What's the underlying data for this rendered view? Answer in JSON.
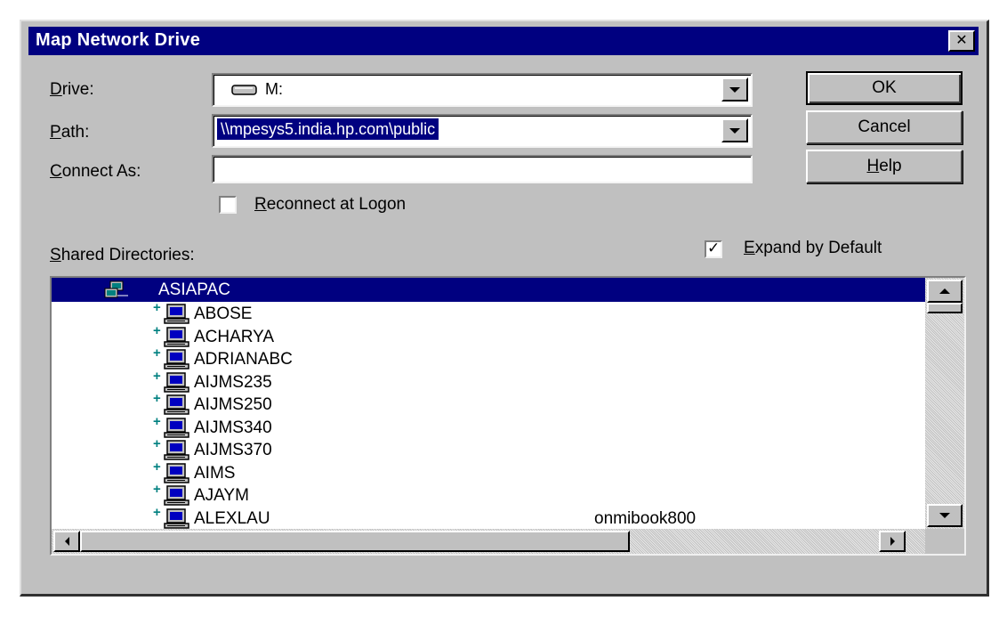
{
  "dialog": {
    "title": "Map Network Drive",
    "close_glyph": "✕"
  },
  "form": {
    "drive": {
      "label_key": "D",
      "label_rest": "rive:",
      "value": "M:"
    },
    "path": {
      "label_key": "P",
      "label_rest": "ath:",
      "value": "\\\\mpesys5.india.hp.com\\public"
    },
    "connect_as": {
      "label_key": "C",
      "label_rest": "onnect As:",
      "value": ""
    },
    "reconnect": {
      "label_key": "R",
      "label_rest": "econnect at Logon",
      "checked": false
    }
  },
  "buttons": {
    "ok": "OK",
    "cancel": "Cancel",
    "help_key": "H",
    "help_rest": "elp"
  },
  "shared": {
    "label_key": "S",
    "label_rest": "hared Directories:",
    "expand_key": "E",
    "expand_rest": "xpand by Default",
    "expand_checked": true,
    "check_glyph": "✓"
  },
  "tree": {
    "root": "ASIAPAC",
    "expander_glyph": "+",
    "items": [
      {
        "name": "ABOSE",
        "comment": ""
      },
      {
        "name": "ACHARYA",
        "comment": ""
      },
      {
        "name": "ADRIANABC",
        "comment": ""
      },
      {
        "name": "AIJMS235",
        "comment": ""
      },
      {
        "name": "AIJMS250",
        "comment": ""
      },
      {
        "name": "AIJMS340",
        "comment": ""
      },
      {
        "name": "AIJMS370",
        "comment": ""
      },
      {
        "name": "AIMS",
        "comment": ""
      },
      {
        "name": "AJAYM",
        "comment": ""
      },
      {
        "name": "ALEXLAU",
        "comment": "onmibook800"
      }
    ]
  },
  "colors": {
    "title_bg": "#000080",
    "selection_bg": "#000080",
    "face": "#c0c0c0",
    "expander": "#008080"
  }
}
